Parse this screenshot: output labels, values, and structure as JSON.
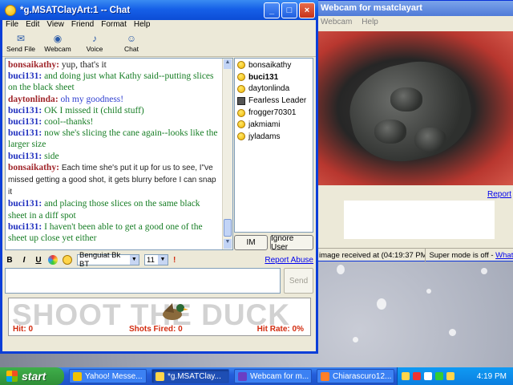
{
  "chat_window": {
    "title": "*g.MSATClayArt:1 -- Chat",
    "menu": [
      "File",
      "Edit",
      "View",
      "Friend",
      "Format",
      "Help"
    ],
    "toolbar": [
      "Send File",
      "Webcam",
      "Voice",
      "Chat"
    ],
    "messages": [
      {
        "user": "bonsaikathy",
        "text": "yup, that's it",
        "user_style": "bonsai",
        "text_style": "black"
      },
      {
        "user": "buci131",
        "text": "and doing just what Kathy said--putting slices on the black sheet",
        "user_style": "buci",
        "text_style": "green"
      },
      {
        "user": "daytonlinda",
        "text": "oh my goodness!",
        "user_style": "dayton",
        "text_style": "blue"
      },
      {
        "user": "buci131",
        "text": "OK I missed it (child stuff)",
        "user_style": "buci",
        "text_style": "green"
      },
      {
        "user": "buci131",
        "text": "cool--thanks!",
        "user_style": "buci",
        "text_style": "green"
      },
      {
        "user": "buci131",
        "text": "now she's slicing the cane again--looks like the larger size",
        "user_style": "buci",
        "text_style": "green"
      },
      {
        "user": "buci131",
        "text": "side",
        "user_style": "buci",
        "text_style": "green"
      },
      {
        "user": "bonsaikathy",
        "text": "Each time she's put it up for us to see, I\"ve missed getting a good shot, it gets blurry before I can snap it",
        "user_style": "bonsai",
        "text_style": "small"
      },
      {
        "user": "buci131",
        "text": "and placing those slices on the same black sheet in a diff spot",
        "user_style": "buci",
        "text_style": "green"
      },
      {
        "user": "buci131",
        "text": "I haven't been able to get a good one of the sheet up close yet either",
        "user_style": "buci",
        "text_style": "green"
      }
    ],
    "users": [
      {
        "name": "bonsaikathy",
        "bold": false,
        "icon": "smiley-icon"
      },
      {
        "name": "buci131",
        "bold": true,
        "icon": "smiley-icon"
      },
      {
        "name": "daytonlinda",
        "bold": false,
        "icon": "smiley-icon"
      },
      {
        "name": "Fearless Leader",
        "bold": false,
        "icon": "webcam-icon"
      },
      {
        "name": "frogger70301",
        "bold": false,
        "icon": "smiley-icon"
      },
      {
        "name": "jakmiami",
        "bold": false,
        "icon": "smiley-icon"
      },
      {
        "name": "jyladams",
        "bold": false,
        "icon": "smiley-icon"
      }
    ],
    "im_label": "IM",
    "ignore_label": "Ignore User",
    "format": {
      "bold": "B",
      "italic": "I",
      "underline": "U",
      "font": "Benguiat Bk BT",
      "size": "11"
    },
    "report_abuse": "Report Abuse",
    "send_label": "Send",
    "ad": {
      "headline": "SHOOT THE DUCK",
      "hit": "Hit: 0",
      "shots_fired": "Shots Fired: 0",
      "hit_rate": "Hit Rate: 0%"
    }
  },
  "webcam_window": {
    "title": "Webcam for msatclayart",
    "menu": [
      "Webcam",
      "Help"
    ],
    "report_link": "Report",
    "status_received": "image received at (04:19:37 PM)",
    "status_super": "Super mode is off - ",
    "status_link": "What"
  },
  "taskbar": {
    "start": "start",
    "tasks": [
      {
        "label": "Yahoo! Messe...",
        "color": "#f2c200",
        "active": false
      },
      {
        "label": "*g.MSATClay...",
        "color": "#ffd54a",
        "active": true
      },
      {
        "label": "Webcam for m...",
        "color": "#6a3fc4",
        "active": false
      },
      {
        "label": "Chiarascuro12...",
        "color": "#ff7f27",
        "active": false
      }
    ],
    "clock": "4:19 PM"
  },
  "colors": {
    "accent": "#0b3ed8",
    "buci": "#1f2fbf",
    "bonsai": "#a0262b",
    "green_text": "#167d24",
    "ad_red": "#d22b0f"
  }
}
